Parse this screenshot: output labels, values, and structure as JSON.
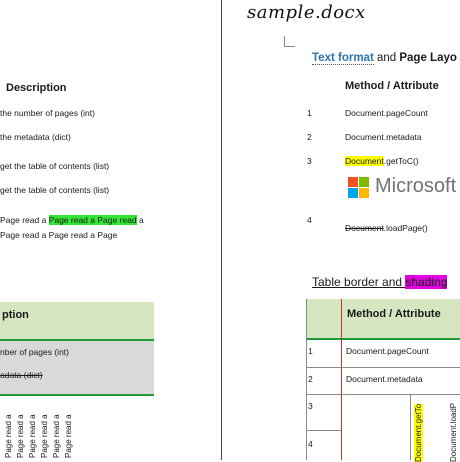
{
  "left_page": {
    "table_header": "Description",
    "rows": [
      "the number of pages (int)",
      "the metadata (dict)",
      "get the table of contents (list)",
      "get the table of contents (list)"
    ],
    "paragraph": {
      "line1_pre": "Page read a ",
      "line1_hl": "Page read a Page read",
      "line1_post": " a",
      "line2": "Page read a Page read a Page"
    },
    "table2_header": "ption",
    "table2_rows": [
      "nber of pages (int)",
      "adata (dict)"
    ],
    "rotated_text": "Page read a"
  },
  "right_page": {
    "doc_title": "sample.docx",
    "heading": {
      "part1": "Text format",
      "part2": " and ",
      "part3": "Page Layo"
    },
    "table1": {
      "header": "Method / Attribute",
      "rows": [
        {
          "num": "1",
          "text": "Document.pageCount"
        },
        {
          "num": "2",
          "text": "Document.metadata"
        },
        {
          "num": "3",
          "text_hl": "Document",
          "text_rest": ".getToC()"
        },
        {
          "num": "4",
          "text_strike": "Document",
          "text_rest": ".loadPage()"
        }
      ],
      "logo_text": "Microsoft"
    },
    "heading2": {
      "part1": "Table border and ",
      "part2": "shading"
    },
    "table2": {
      "header": "Method / Attribute",
      "rows": [
        {
          "num": "1",
          "text": "Document.pageCount"
        },
        {
          "num": "2",
          "text": "Document.metadata"
        },
        {
          "num": "3",
          "text": ""
        },
        {
          "num": "4",
          "text": ""
        }
      ],
      "rot_col1": "Document.getTo",
      "rot_col2": "Document.loadP"
    }
  },
  "colors": {
    "heading_blue": "#2e74b5",
    "green_band": "#d6e6c0",
    "green_rule": "#1f9a3a",
    "highlight_yellow": "#ffff00",
    "highlight_green": "#32e632",
    "highlight_magenta": "#e000e0"
  },
  "logo": {
    "icon": "microsoft-logo-icon",
    "squares": [
      "#f25022",
      "#7fba00",
      "#00a4ef",
      "#ffb900"
    ]
  }
}
